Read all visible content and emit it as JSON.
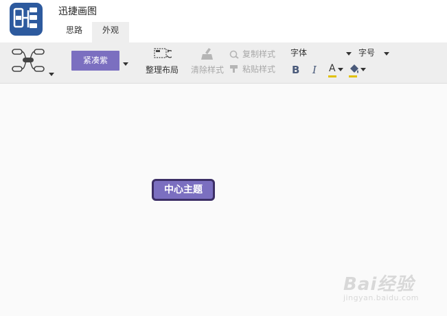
{
  "app": {
    "title": "迅捷画图",
    "icon": "mindmap-app-icon"
  },
  "tabs": [
    {
      "label": "思路",
      "active": false
    },
    {
      "label": "外观",
      "active": true
    }
  ],
  "toolbar": {
    "structure_icon": "mindmap-structure-icon",
    "theme_label": "紧凑紫",
    "layout_label": "整理布局",
    "clear_label": "清除样式",
    "copy_style_label": "复制样式",
    "paste_style_label": "粘贴样式",
    "font_label": "字体",
    "size_label": "字号",
    "bold_label": "B",
    "italic_label": "I",
    "font_color_label": "A"
  },
  "canvas": {
    "central_topic": "中心主题"
  },
  "watermark": {
    "main": "Bai经验",
    "sub": "jingyan.baidu.com"
  },
  "colors": {
    "theme_purple": "#7b6fc0",
    "node_border": "#3c2f66",
    "app_icon_bg": "#2d5a9e",
    "font_color_underline": "#e0c000"
  }
}
